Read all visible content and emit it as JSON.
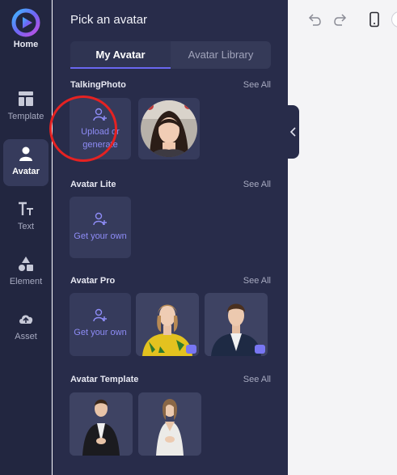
{
  "rail": {
    "home_label": "Home",
    "items": [
      {
        "label": "Template",
        "icon": "template-icon"
      },
      {
        "label": "Avatar",
        "icon": "avatar-icon",
        "active": true
      },
      {
        "label": "Text",
        "icon": "text-icon"
      },
      {
        "label": "Element",
        "icon": "element-icon"
      },
      {
        "label": "Asset",
        "icon": "asset-icon"
      }
    ]
  },
  "panel": {
    "title": "Pick an avatar",
    "tabs": [
      "My Avatar",
      "Avatar Library"
    ],
    "sections": [
      {
        "title": "TalkingPhoto",
        "see_all": "See All",
        "upload_line1": "Upload or",
        "upload_line2": "generate"
      },
      {
        "title": "Avatar Lite",
        "see_all": "See All",
        "upload_text": "Get your own"
      },
      {
        "title": "Avatar Pro",
        "see_all": "See All",
        "upload_text": "Get your own"
      },
      {
        "title": "Avatar Template",
        "see_all": "See All"
      }
    ]
  },
  "colors": {
    "rail_bg": "#222640",
    "panel_bg": "#282c4a",
    "card_bg": "#363b5c",
    "accent": "#8e8cf6",
    "annotation": "#e52222"
  }
}
